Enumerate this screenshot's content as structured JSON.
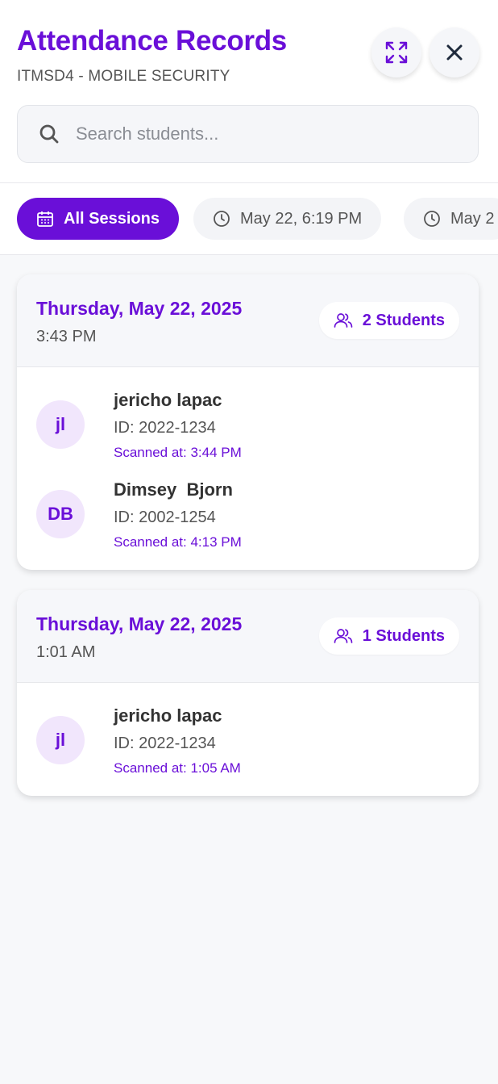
{
  "header": {
    "title": "Attendance Records",
    "subtitle": "ITMSD4 - MOBILE SECURITY",
    "expand_icon": "expand-icon",
    "close_icon": "close-icon"
  },
  "search": {
    "placeholder": "Search students...",
    "value": ""
  },
  "filters": [
    {
      "label": "All Sessions",
      "icon": "calendar-icon",
      "active": true
    },
    {
      "label": "May 22, 6:19 PM",
      "icon": "clock-icon",
      "active": false
    },
    {
      "label": "May 2",
      "icon": "clock-icon",
      "active": false
    }
  ],
  "sessions": [
    {
      "date": "Thursday, May 22, 2025",
      "time": "3:43 PM",
      "count_label": "2 Students",
      "students": [
        {
          "initials": "jl",
          "name": "jericho lapac",
          "id": "ID: 2022-1234",
          "scanned": "Scanned at: 3:44 PM"
        },
        {
          "initials": "DB",
          "name": "Dimsey  Bjorn",
          "id": "ID: 2002-1254",
          "scanned": "Scanned at: 4:13 PM"
        }
      ]
    },
    {
      "date": "Thursday, May 22, 2025",
      "time": "1:01 AM",
      "count_label": "1 Students",
      "students": [
        {
          "initials": "jl",
          "name": "jericho lapac",
          "id": "ID: 2022-1234",
          "scanned": "Scanned at: 1:05 AM"
        }
      ]
    }
  ],
  "colors": {
    "accent": "#6a0fd8",
    "avatar_bg": "#f1e6fc",
    "background": "#f7f8fa"
  }
}
